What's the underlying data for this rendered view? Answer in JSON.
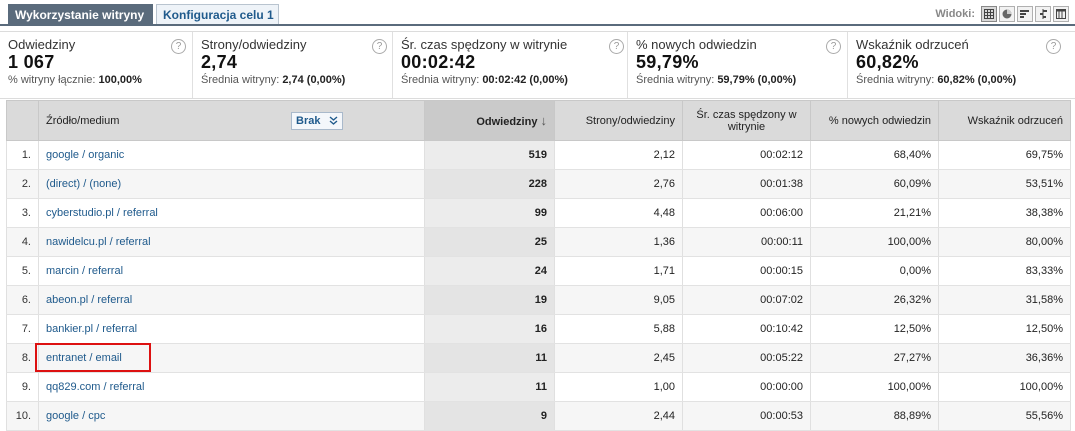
{
  "tabs": [
    {
      "label": "Wykorzystanie witryny",
      "active": true
    },
    {
      "label": "Konfiguracja celu 1",
      "active": false
    }
  ],
  "views": {
    "label": "Widoki:",
    "buttons": [
      "table-view-icon",
      "pie-view-icon",
      "bar-view-icon",
      "compare-view-icon",
      "pivot-view-icon"
    ]
  },
  "scorecard": [
    {
      "label": "Odwiedziny",
      "value": "1 067",
      "sub_prefix": "% witryny łącznie: ",
      "sub_value": "100,00%"
    },
    {
      "label": "Strony/odwiedziny",
      "value": "2,74",
      "sub_prefix": "Średnia witryny: ",
      "sub_value": "2,74 (0,00%)"
    },
    {
      "label": "Śr. czas spędzony w witrynie",
      "value": "00:02:42",
      "sub_prefix": "Średnia witryny: ",
      "sub_value": "00:02:42 (0,00%)"
    },
    {
      "label": "% nowych odwiedzin",
      "value": "59,79%",
      "sub_prefix": "Średnia witryny: ",
      "sub_value": "59,79% (0,00%)"
    },
    {
      "label": "Wskaźnik odrzuceń",
      "value": "60,82%",
      "sub_prefix": "Średnia witryny: ",
      "sub_value": "60,82% (0,00%)"
    }
  ],
  "help_glyph": "?",
  "table": {
    "headers": {
      "dimension": "Źródło/medium",
      "secondary": "Brak",
      "visits": "Odwiedziny",
      "sort_arrow": "↓",
      "pages": "Strony/odwiedziny",
      "time": "Śr. czas spędzony w witrynie",
      "new": "% nowych odwiedzin",
      "bounce": "Wskaźnik odrzuceń"
    },
    "rows": [
      {
        "idx": "1.",
        "source": "google / organic",
        "visits": "519",
        "pages": "2,12",
        "time": "00:02:12",
        "new": "68,40%",
        "bounce": "69,75%"
      },
      {
        "idx": "2.",
        "source": "(direct) / (none)",
        "visits": "228",
        "pages": "2,76",
        "time": "00:01:38",
        "new": "60,09%",
        "bounce": "53,51%"
      },
      {
        "idx": "3.",
        "source": "cyberstudio.pl / referral",
        "visits": "99",
        "pages": "4,48",
        "time": "00:06:00",
        "new": "21,21%",
        "bounce": "38,38%"
      },
      {
        "idx": "4.",
        "source": "nawidelcu.pl / referral",
        "visits": "25",
        "pages": "1,36",
        "time": "00:00:11",
        "new": "100,00%",
        "bounce": "80,00%"
      },
      {
        "idx": "5.",
        "source": "marcin / referral",
        "visits": "24",
        "pages": "1,71",
        "time": "00:00:15",
        "new": "0,00%",
        "bounce": "83,33%"
      },
      {
        "idx": "6.",
        "source": "abeon.pl / referral",
        "visits": "19",
        "pages": "9,05",
        "time": "00:07:02",
        "new": "26,32%",
        "bounce": "31,58%"
      },
      {
        "idx": "7.",
        "source": "bankier.pl / referral",
        "visits": "16",
        "pages": "5,88",
        "time": "00:10:42",
        "new": "12,50%",
        "bounce": "12,50%"
      },
      {
        "idx": "8.",
        "source": "entranet / email",
        "visits": "11",
        "pages": "2,45",
        "time": "00:05:22",
        "new": "27,27%",
        "bounce": "36,36%"
      },
      {
        "idx": "9.",
        "source": "qq829.com / referral",
        "visits": "11",
        "pages": "1,00",
        "time": "00:00:00",
        "new": "100,00%",
        "bounce": "100,00%"
      },
      {
        "idx": "10.",
        "source": "google / cpc",
        "visits": "9",
        "pages": "2,44",
        "time": "00:00:53",
        "new": "88,89%",
        "bounce": "55,56%"
      }
    ]
  },
  "colors": {
    "highlight": "#dd1111",
    "link": "#1f5a8c",
    "active_tab": "#5a6b7c"
  }
}
